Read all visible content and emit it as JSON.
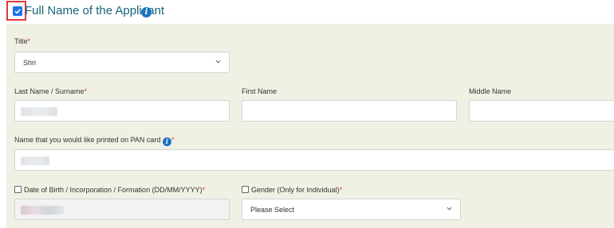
{
  "header": {
    "title": "Full Name of the Applicant",
    "checkbox_checked": true,
    "info_icon": "info-icon"
  },
  "form": {
    "title": {
      "label": "Title",
      "required_mark": "*",
      "value": "Shri"
    },
    "last_name": {
      "label": "Last Name / Surname",
      "required_mark": "*",
      "value": ""
    },
    "first_name": {
      "label": "First Name",
      "value": ""
    },
    "middle_name": {
      "label": "Middle Name",
      "value": ""
    },
    "pan_name": {
      "label": "Name that you would like printed on PAN card",
      "required_mark": "*",
      "value": "",
      "info_icon": "info-icon"
    },
    "dob": {
      "label": "Date of Birth / Incorporation / Formation (DD/MM/YYYY)",
      "required_mark": "*",
      "value": ""
    },
    "gender": {
      "label": "Gender (Only for Individual)",
      "required_mark": "*",
      "value": "Please Select"
    }
  },
  "colors": {
    "accent": "#1a73e8",
    "header_text": "#17647a",
    "required": "#d9342b",
    "highlight_border": "#e0393a",
    "panel_bg": "#f0f0e4"
  }
}
